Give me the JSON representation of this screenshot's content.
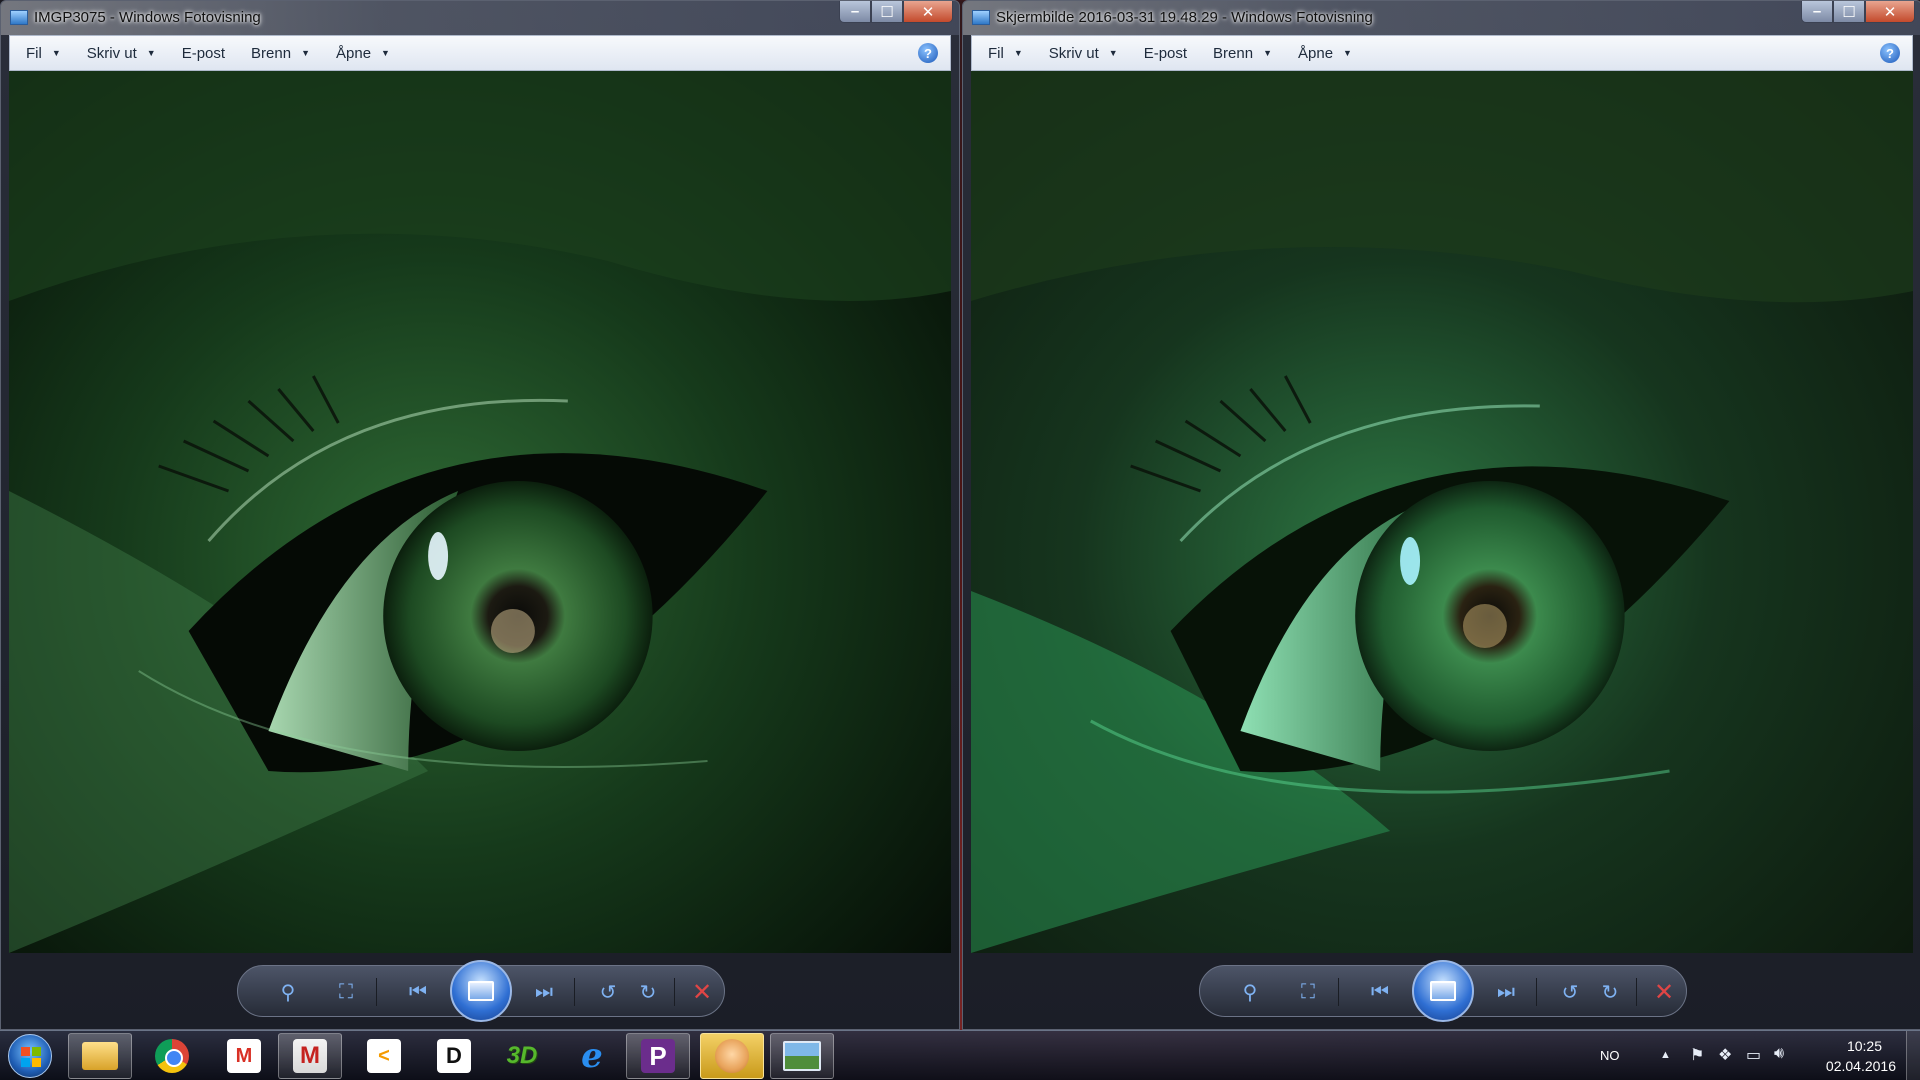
{
  "windows": [
    {
      "title": "IMGP3075 - Windows Fotovisning",
      "menu": [
        {
          "label": "Fil",
          "dropdown": true
        },
        {
          "label": "Skriv ut",
          "dropdown": true
        },
        {
          "label": "E-post",
          "dropdown": false
        },
        {
          "label": "Brenn",
          "dropdown": true
        },
        {
          "label": "Åpne",
          "dropdown": true
        }
      ],
      "image": "eye-photo-original"
    },
    {
      "title": "Skjermbilde 2016-03-31 19.48.29 - Windows Fotovisning",
      "menu": [
        {
          "label": "Fil",
          "dropdown": true
        },
        {
          "label": "Skriv ut",
          "dropdown": true
        },
        {
          "label": "E-post",
          "dropdown": false
        },
        {
          "label": "Brenn",
          "dropdown": true
        },
        {
          "label": "Åpne",
          "dropdown": true
        }
      ],
      "image": "eye-photo-screenshot"
    }
  ],
  "window_buttons": {
    "minimize": "–",
    "maximize": "☐",
    "close": "✕"
  },
  "help": "?",
  "controls": {
    "zoom": "zoom-icon",
    "fit": "actual-size-icon",
    "previous": "previous-icon",
    "slideshow": "slideshow-icon",
    "next": "next-icon",
    "rotate_left": "rotate-counterclockwise-icon",
    "rotate_right": "rotate-clockwise-icon",
    "delete": "delete-icon"
  },
  "taskbar": {
    "apps": [
      {
        "name": "windows-explorer",
        "icon": "folder-icon"
      },
      {
        "name": "google-chrome",
        "icon": "chrome-icon"
      },
      {
        "name": "gmail",
        "icon": "gmail-icon",
        "label": "M"
      },
      {
        "name": "gmail-notifier",
        "icon": "gmail-envelope-icon",
        "label": "M"
      },
      {
        "name": "share-app",
        "icon": "share-icon",
        "label": "<"
      },
      {
        "name": "d-app",
        "icon": "d-icon",
        "label": "D"
      },
      {
        "name": "3d-app",
        "icon": "3d-icon",
        "label": "3D"
      },
      {
        "name": "internet-explorer",
        "icon": "ie-icon",
        "label": "e"
      },
      {
        "name": "p-app",
        "icon": "p-icon",
        "label": "P"
      },
      {
        "name": "avatar-app",
        "icon": "face-icon"
      },
      {
        "name": "windows-photo-viewer",
        "icon": "photo-viewer-icon"
      }
    ],
    "tray": {
      "language": "NO",
      "time": "10:25",
      "date": "02.04.2016"
    }
  },
  "colors": {
    "photo_left_tint": "#1f5a24",
    "photo_right_tint": "#1d6a3a",
    "accent_blue": "#2f6fd3",
    "delete_red": "#e04545"
  }
}
